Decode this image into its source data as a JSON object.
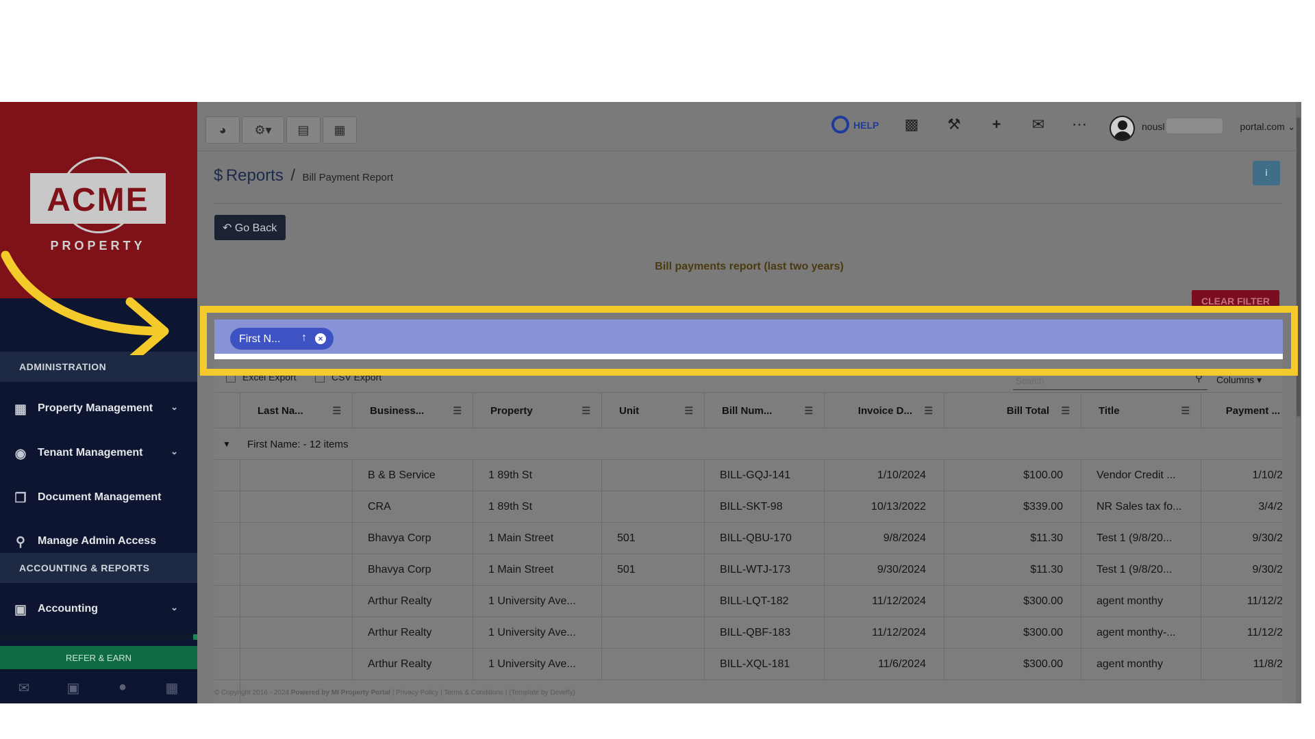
{
  "sidebar": {
    "logo_text": "ACME",
    "logo_sub": "PROPERTY",
    "section_admin": "ADMINISTRATION",
    "section_accounting": "ACCOUNTING & REPORTS",
    "items": [
      {
        "label": "Property Management",
        "icon": "building-icon"
      },
      {
        "label": "Tenant Management",
        "icon": "users-icon"
      },
      {
        "label": "Document Management",
        "icon": "documents-icon"
      },
      {
        "label": "Manage Admin Access",
        "icon": "key-icon"
      },
      {
        "label": "Accounting",
        "icon": "money-icon"
      }
    ],
    "refer_label": "REFER & EARN"
  },
  "topbar": {
    "help_label": "HELP",
    "user_email_start": "nousl",
    "user_email_end": "portal.com"
  },
  "breadcrumb": {
    "symbol": "$",
    "title": "Reports",
    "separator": "/",
    "current": "Bill Payment Report"
  },
  "go_back_label": "Go Back",
  "report_title": "Bill payments report (last two years)",
  "clear_filter_label": "CLEAR FILTER",
  "group_chip_label": "First N...",
  "excel_export_label": "Excel Export",
  "csv_export_label": "CSV Export",
  "search_placeholder": "Search",
  "columns_label": "Columns",
  "columns": [
    "Last Na...",
    "Business...",
    "Property",
    "Unit",
    "Bill Num...",
    "Invoice D...",
    "Bill Total",
    "Title",
    "Payment ..."
  ],
  "group_label": "First Name: - 12 items",
  "rows": [
    {
      "last": "",
      "business": "B & B Service",
      "property": "1 89th St",
      "unit": "",
      "bill": "BILL-GQJ-141",
      "invoice": "1/10/2024",
      "total": "$100.00",
      "title": "Vendor Credit ...",
      "payment": "1/10/2"
    },
    {
      "last": "",
      "business": "CRA",
      "property": "1 89th St",
      "unit": "",
      "bill": "BILL-SKT-98",
      "invoice": "10/13/2022",
      "total": "$339.00",
      "title": "NR Sales tax fo...",
      "payment": "3/4/2"
    },
    {
      "last": "",
      "business": "Bhavya Corp",
      "property": "1 Main Street",
      "unit": "501",
      "bill": "BILL-QBU-170",
      "invoice": "9/8/2024",
      "total": "$11.30",
      "title": "Test 1 (9/8/20...",
      "payment": "9/30/2"
    },
    {
      "last": "",
      "business": "Bhavya Corp",
      "property": "1 Main Street",
      "unit": "501",
      "bill": "BILL-WTJ-173",
      "invoice": "9/30/2024",
      "total": "$11.30",
      "title": "Test 1 (9/8/20...",
      "payment": "9/30/2"
    },
    {
      "last": "",
      "business": "Arthur Realty",
      "property": "1 University Ave...",
      "unit": "",
      "bill": "BILL-LQT-182",
      "invoice": "11/12/2024",
      "total": "$300.00",
      "title": "agent monthy",
      "payment": "11/12/2"
    },
    {
      "last": "",
      "business": "Arthur Realty",
      "property": "1 University Ave...",
      "unit": "",
      "bill": "BILL-QBF-183",
      "invoice": "11/12/2024",
      "total": "$300.00",
      "title": "agent monthy-...",
      "payment": "11/12/2"
    },
    {
      "last": "",
      "business": "Arthur Realty",
      "property": "1 University Ave...",
      "unit": "",
      "bill": "BILL-XQL-181",
      "invoice": "11/6/2024",
      "total": "$300.00",
      "title": "agent monthy",
      "payment": "11/8/2"
    }
  ],
  "footer": {
    "copyright": "© Copyright 2016 - 2024",
    "powered": "Powered by MI Property Portal",
    "privacy": "Privacy Policy",
    "terms": "Terms & Conditions",
    "template": "(Template by Devefly)"
  },
  "colors": {
    "highlight": "#f5cb2c",
    "sidebar": "#0d1530",
    "logo_bg": "#7e1218",
    "group_panel": "#8793d4",
    "chip": "#3d53c4"
  }
}
